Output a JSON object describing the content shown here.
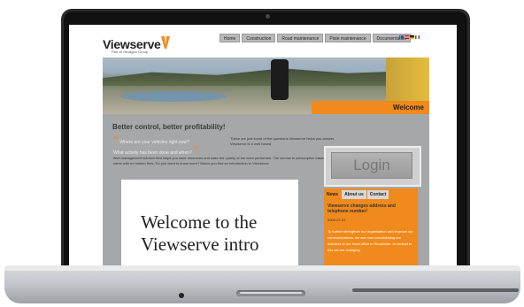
{
  "site": {
    "logo_text": "Viewserve",
    "logo_sub": "Part of Hexagon Group",
    "nav": [
      "Home",
      "Construction",
      "Road maintenance",
      "Piste maintenance",
      "Documentation"
    ],
    "welcome": "Welcome",
    "tagline": "Better control, better profitability!",
    "quote_lines": [
      "Where are your vehicles right now?",
      "What activity has been done and when?"
    ],
    "quote_right": "These are just some of the questions Viewserve helps you answer. Viewserve is a web based",
    "body_text": "fleet management solution that helps you save resources and raise the quality of the work performed. The service is subscription based and come with no hidden fees. Do you want to know more? Below you find an introduction to Viewserve.",
    "video_title": "Welcome to the Viewserve intro",
    "login_label": "Login",
    "news_tabs": [
      "News",
      "About us",
      "Contact"
    ],
    "news_title": "Viewserve changes address and telephone number!",
    "news_date": "2009-07-01",
    "news_text": "To further strengthen our organisation and improve our communications, we are now consolidating our activities to our head office in Stockholm. In contact to this we are changing"
  },
  "colors": {
    "accent": "#f08a1c",
    "content_bg": "#a6a7a9"
  },
  "icons": {
    "camera": "camera-icon",
    "flags": [
      "sweden-flag-icon",
      "uk-flag-icon",
      "germany-flag-icon",
      "italy-flag-icon"
    ]
  }
}
